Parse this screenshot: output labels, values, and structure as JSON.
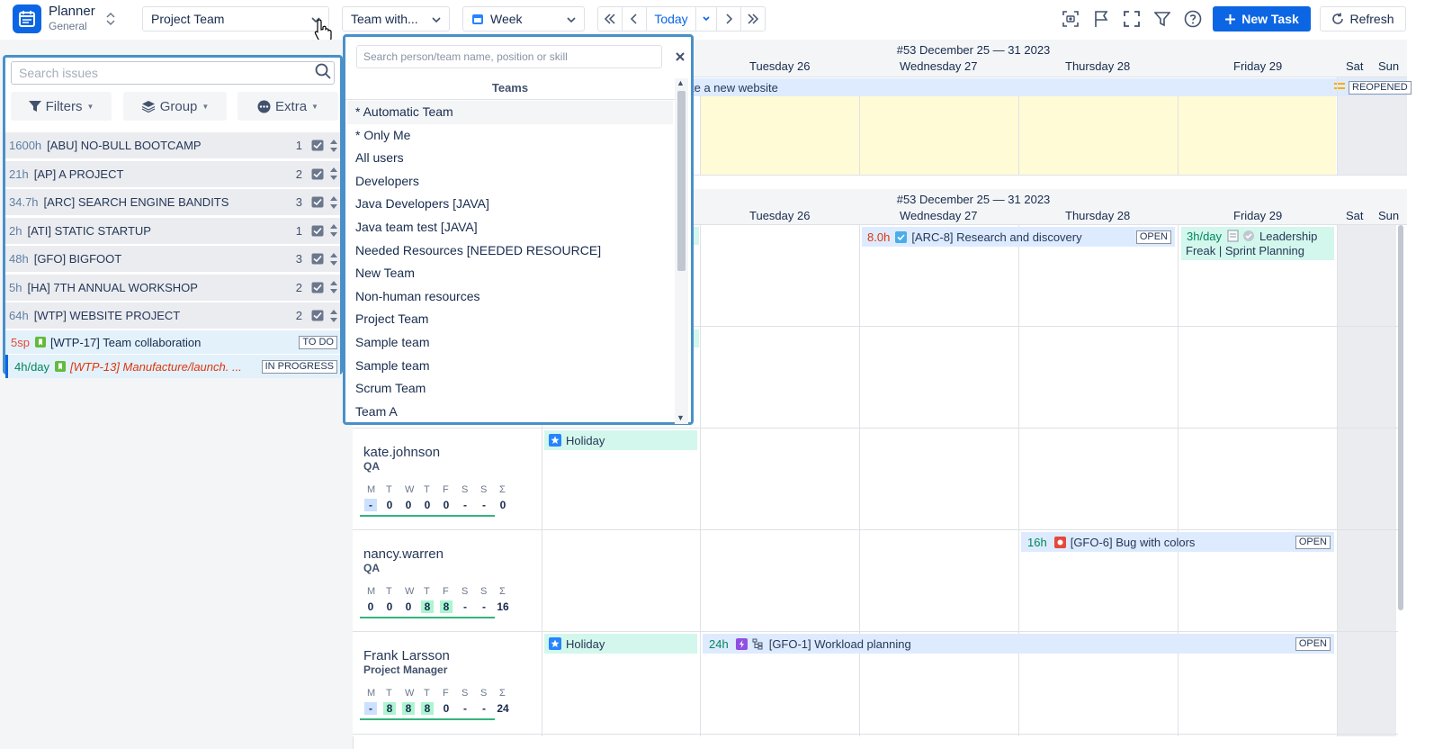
{
  "app": {
    "name": "Planner",
    "subtitle": "General"
  },
  "toolbar": {
    "team_select": "Project Team",
    "team_with": "Team with...",
    "view_select": "Week",
    "today": "Today",
    "new_task": "New Task",
    "refresh": "Refresh"
  },
  "left_panel": {
    "search_placeholder": "Search issues",
    "filters": "Filters",
    "group": "Group",
    "extra": "Extra",
    "projects": [
      {
        "hours": "1600h",
        "name": "[ABU] NO-BULL BOOTCAMP",
        "count": "1"
      },
      {
        "hours": "21h",
        "name": "[AP] A PROJECT",
        "count": "2"
      },
      {
        "hours": "34.7h",
        "name": "[ARC] SEARCH ENGINE BANDITS",
        "count": "3"
      },
      {
        "hours": "2h",
        "name": "[ATI] STATIC STARTUP",
        "count": "1"
      },
      {
        "hours": "48h",
        "name": "[GFO] BIGFOOT",
        "count": "3"
      },
      {
        "hours": "5h",
        "name": "[HA] 7TH ANNUAL WORKSHOP",
        "count": "2"
      },
      {
        "hours": "64h",
        "name": "[WTP] WEBSITE PROJECT",
        "count": "2"
      }
    ],
    "issues": [
      {
        "estimate": "5sp",
        "title": "[WTP-17] Team collaboration",
        "status": "TO DO"
      },
      {
        "estimate": "4h/day",
        "title": "[WTP-13] Manufacture/launch. ...",
        "status": "IN PROGRESS"
      }
    ]
  },
  "dropdown": {
    "search_placeholder": "Search person/team name, position or skill",
    "header": "Teams",
    "items": [
      "* Automatic Team",
      "* Only Me",
      "All users",
      "Developers",
      "Java Developers [JAVA]",
      "Java team test [JAVA]",
      "Needed Resources [NEEDED RESOURCE]",
      "New Team",
      "Non-human resources",
      "Project Team",
      "Sample team",
      "Sample team",
      "Scrum Team",
      "Team A"
    ]
  },
  "calendar": {
    "week_title": "#53 December 25 — 31 2023",
    "days": [
      "Tuesday 26",
      "Wednesday 27",
      "Thursday 28",
      "Friday 29",
      "Sat",
      "Sun"
    ],
    "top_event": {
      "title": "te a new website",
      "status": "REOPENED"
    },
    "events": {
      "arc8": {
        "hours": "8.0h",
        "title": "[ARC-8] Research and discovery",
        "status": "OPEN"
      },
      "leadership": {
        "rate": "3h/day",
        "title": "Leadership",
        "title2": "Freak | Sprint Planning"
      },
      "kate_holiday": "Holiday",
      "gfo6": {
        "hours": "16h",
        "title": "[GFO-6] Bug with colors",
        "status": "OPEN"
      },
      "frank_holiday": "Holiday",
      "gfo1": {
        "hours": "24h",
        "title": "[GFO-1] Workload planning",
        "status": "OPEN"
      }
    },
    "week_letters": [
      "M",
      "T",
      "W",
      "T",
      "F",
      "S",
      "S",
      "Σ"
    ],
    "users": [
      {
        "name": "kate.johnson",
        "role": "QA",
        "values": [
          "-",
          "0",
          "0",
          "0",
          "0",
          "-",
          "-",
          "0"
        ]
      },
      {
        "name": "nancy.warren",
        "role": "QA",
        "values": [
          "0",
          "0",
          "0",
          "8",
          "8",
          "-",
          "-",
          "16"
        ]
      },
      {
        "name": "Frank Larsson",
        "role": "Project Manager",
        "values": [
          "-",
          "8",
          "8",
          "8",
          "0",
          "-",
          "-",
          "24"
        ]
      }
    ]
  }
}
